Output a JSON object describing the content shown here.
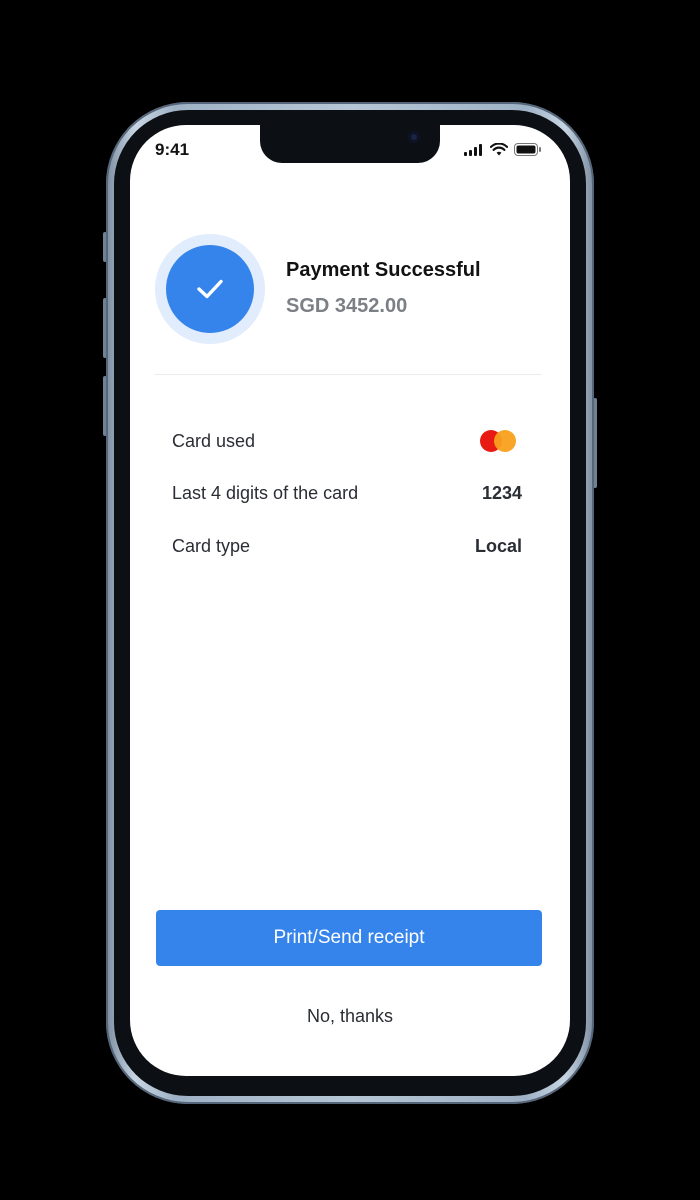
{
  "status_bar": {
    "time": "9:41",
    "icons": [
      "cellular-signal-icon",
      "wifi-icon",
      "battery-icon"
    ]
  },
  "payment": {
    "title": "Payment Successful",
    "amount": "SGD 3452.00",
    "status_icon": "check-icon"
  },
  "details": [
    {
      "label": "Card used",
      "value": "",
      "icon": "mastercard-logo"
    },
    {
      "label": "Last 4 digits of the card",
      "value": "1234"
    },
    {
      "label": "Card type",
      "value": "Local"
    }
  ],
  "actions": {
    "primary_label": "Print/Send receipt",
    "secondary_label": "No, thanks"
  },
  "colors": {
    "accent": "#3584ec",
    "accent_light": "#e1ecfc",
    "mastercard_red": "#e81a14",
    "mastercard_orange": "#f8a01c",
    "muted_text": "#7b7f86"
  }
}
